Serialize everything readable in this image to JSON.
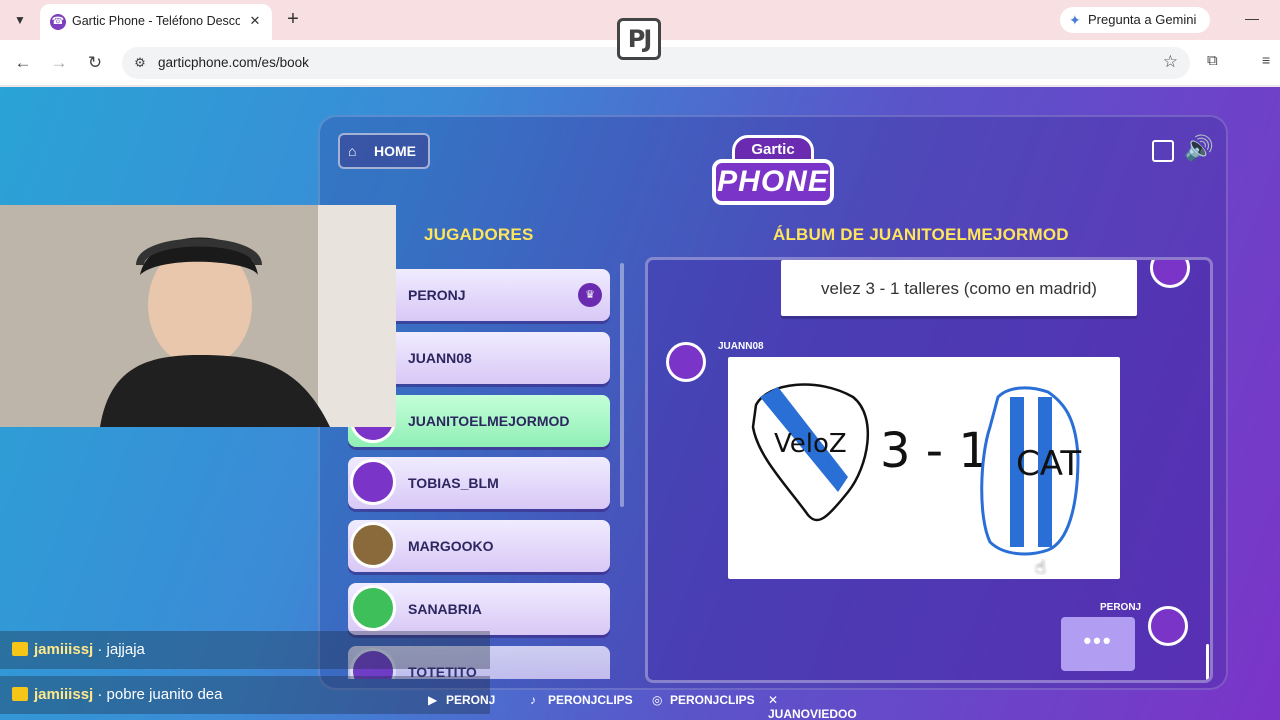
{
  "browser": {
    "tab_title": "Gartic Phone - Teléfono Descon",
    "new_tab": "+",
    "gemini": "Pregunta a Gemini",
    "url": "garticphone.com/es/book"
  },
  "stream": {
    "logo": "PJ"
  },
  "game": {
    "home": "HOME",
    "logo_top": "Gartic",
    "logo_main": "PHONE",
    "players_title": "JUGADORES",
    "album_title": "ÁLBUM DE JUANITOELMEJORMOD",
    "players": [
      {
        "name": "PERONJ",
        "host": true
      },
      {
        "name": "JUANN08"
      },
      {
        "name": "JUANITOELMEJORMOD",
        "active": true
      },
      {
        "name": "TOBIAS_BLM"
      },
      {
        "name": "MARGOOKO"
      },
      {
        "name": "SANABRIA"
      },
      {
        "name": "TOTETITO"
      }
    ],
    "album": {
      "first_text": "velez 3 - 1 talleres (como en madrid)",
      "drawing_author": "JUANN08",
      "drawing_labels": {
        "left": "VeloZ",
        "score": "3 - 1",
        "right": "CAT"
      },
      "typing_author": "PERONJ",
      "typing": "•••"
    }
  },
  "chat": [
    {
      "user": "jamiiissj",
      "text": "· jajjaja"
    },
    {
      "user": "jamiiissj",
      "text": "· pobre juanito dea"
    }
  ],
  "socials": [
    {
      "icon": "youtube-icon",
      "label": "PERONJ"
    },
    {
      "icon": "tiktok-icon",
      "label": "PERONJCLIPS"
    },
    {
      "icon": "instagram-icon",
      "label": "PERONJCLIPS"
    },
    {
      "icon": "x-icon",
      "label": "JUANOVIEDOO"
    }
  ]
}
